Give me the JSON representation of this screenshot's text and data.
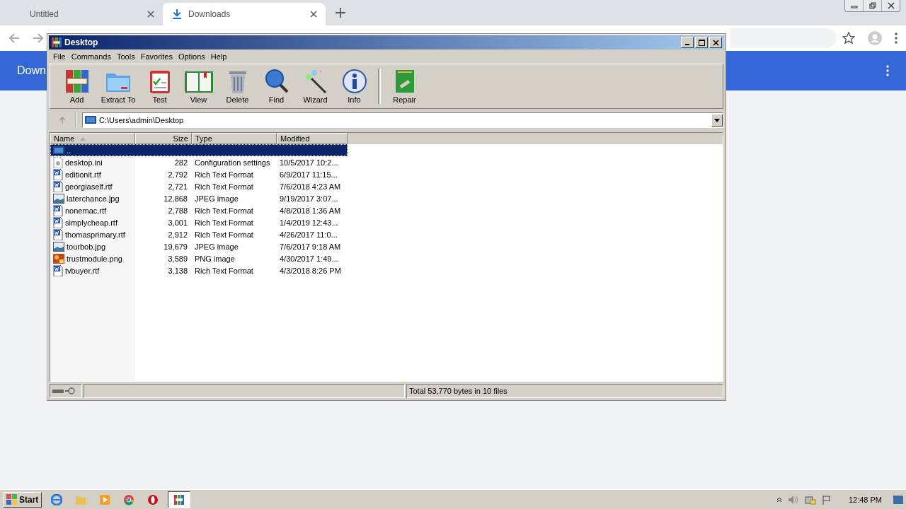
{
  "browser": {
    "tabs": [
      {
        "title": "Untitled",
        "selected": false
      },
      {
        "title": "Downloads",
        "selected": true
      }
    ],
    "page_header": "Down"
  },
  "window": {
    "title": "Desktop",
    "menu": [
      "File",
      "Commands",
      "Tools",
      "Favorites",
      "Options",
      "Help"
    ],
    "toolbar": [
      {
        "label": "Add",
        "kind": "add"
      },
      {
        "label": "Extract To",
        "kind": "extract"
      },
      {
        "label": "Test",
        "kind": "test"
      },
      {
        "label": "View",
        "kind": "view"
      },
      {
        "label": "Delete",
        "kind": "delete"
      },
      {
        "label": "Find",
        "kind": "find"
      },
      {
        "label": "Wizard",
        "kind": "wizard"
      },
      {
        "label": "Info",
        "kind": "info"
      },
      {
        "label": "Repair",
        "kind": "repair"
      }
    ],
    "path": "C:\\Users\\admin\\Desktop",
    "columns": [
      "Name",
      "Size",
      "Type",
      "Modified"
    ],
    "rows": [
      {
        "name": "..",
        "kind": "up",
        "size": "",
        "type": "",
        "modified": "",
        "selected": true
      },
      {
        "name": "desktop.ini",
        "kind": "ini",
        "size": "282",
        "type": "Configuration settings",
        "modified": "10/5/2017 10:2...",
        "selected": false
      },
      {
        "name": "editionit.rtf",
        "kind": "rtf",
        "size": "2,792",
        "type": "Rich Text Format",
        "modified": "6/9/2017 11:15...",
        "selected": false
      },
      {
        "name": "georgiaself.rtf",
        "kind": "rtf",
        "size": "2,721",
        "type": "Rich Text Format",
        "modified": "7/6/2018 4:23 AM",
        "selected": false
      },
      {
        "name": "laterchance.jpg",
        "kind": "jpg",
        "size": "12,868",
        "type": "JPEG image",
        "modified": "9/19/2017 3:07...",
        "selected": false
      },
      {
        "name": "nonemac.rtf",
        "kind": "rtf",
        "size": "2,788",
        "type": "Rich Text Format",
        "modified": "4/8/2018 1:36 AM",
        "selected": false
      },
      {
        "name": "simplycheap.rtf",
        "kind": "rtf",
        "size": "3,001",
        "type": "Rich Text Format",
        "modified": "1/4/2019 12:43...",
        "selected": false
      },
      {
        "name": "thomasprimary.rtf",
        "kind": "rtf",
        "size": "2,912",
        "type": "Rich Text Format",
        "modified": "4/26/2017 11:0...",
        "selected": false
      },
      {
        "name": "tourbob.jpg",
        "kind": "jpg",
        "size": "19,679",
        "type": "JPEG image",
        "modified": "7/6/2017 9:18 AM",
        "selected": false
      },
      {
        "name": "trustmodule.png",
        "kind": "png",
        "size": "3,589",
        "type": "PNG image",
        "modified": "4/30/2017 1:49...",
        "selected": false
      },
      {
        "name": "tvbuyer.rtf",
        "kind": "rtf",
        "size": "3,138",
        "type": "Rich Text Format",
        "modified": "4/3/2018 8:26 PM",
        "selected": false
      }
    ],
    "status": "Total 53,770 bytes in 10 files"
  },
  "taskbar": {
    "start": "Start",
    "clock": "12:48 PM"
  }
}
